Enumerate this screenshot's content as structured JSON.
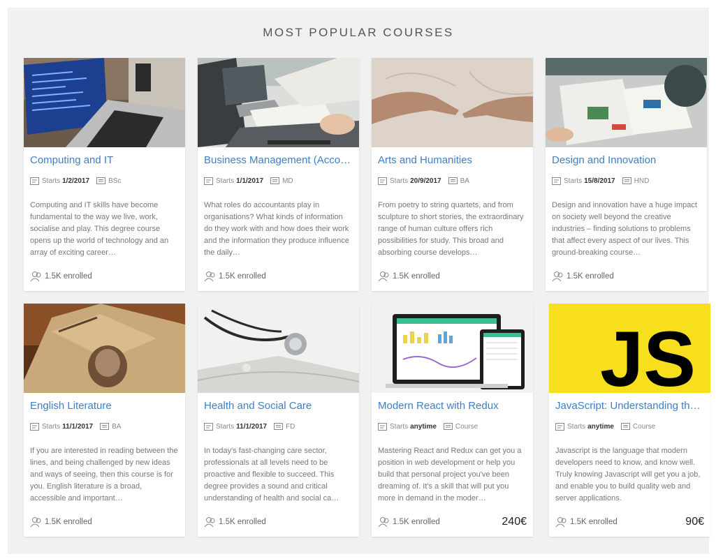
{
  "section": {
    "title": "MOST POPULAR COURSES"
  },
  "courses": [
    {
      "title": "Computing and IT",
      "starts_label": "Starts",
      "starts": "1/2/2017",
      "award": "BSc",
      "description": "Computing and IT skills have become fundamental to the way we live, work, socialise and play. This degree course opens up the world of technology and an array of exciting career…",
      "enrolled": "1.5K enrolled",
      "price": ""
    },
    {
      "title": "Business Management (Acco…",
      "starts_label": "Starts",
      "starts": "1/1/2017",
      "award": "MD",
      "description": "What roles do accountants play in organisations? What kinds of information do they work with and how does their work and the information they produce influence the daily…",
      "enrolled": "1.5K enrolled",
      "price": ""
    },
    {
      "title": "Arts and Humanities",
      "starts_label": "Starts",
      "starts": "20/9/2017",
      "award": "BA",
      "description": "From poetry to string quartets, and from sculpture to short stories, the extraordinary range of human culture offers rich possibilities for study. This broad and absorbing course develops…",
      "enrolled": "1.5K enrolled",
      "price": ""
    },
    {
      "title": "Design and Innovation",
      "starts_label": "Starts",
      "starts": "15/8/2017",
      "award": "HND",
      "description": "Design and innovation have a huge impact on society well beyond the creative industries – finding solutions to problems that affect every aspect of our lives. This ground-breaking course…",
      "enrolled": "1.5K enrolled",
      "price": ""
    },
    {
      "title": "English Literature",
      "starts_label": "Starts",
      "starts": "11/1/2017",
      "award": "BA",
      "description": "If you are interested in reading between the lines, and being challenged by new ideas and ways of seeing, then this course is for you. English literature is a broad, accessible and important…",
      "enrolled": "1.5K enrolled",
      "price": ""
    },
    {
      "title": "Health and Social Care",
      "starts_label": "Starts",
      "starts": "11/1/2017",
      "award": "FD",
      "description": "In today's fast-changing care sector, professionals at all levels need to be proactive and flexible to succeed. This degree provides a sound and critical understanding of health and social ca…",
      "enrolled": "1.5K enrolled",
      "price": ""
    },
    {
      "title": "Modern React with Redux",
      "starts_label": "Starts",
      "starts": "anytime",
      "award": "Course",
      "description": "Mastering React and Redux can get you a position in web development or help you build that personal project you've been dreaming of. It's a skill that will put you more in demand in the moder…",
      "enrolled": "1.5K enrolled",
      "price": "240€"
    },
    {
      "title": "JavaScript: Understanding the…",
      "starts_label": "Starts",
      "starts": "anytime",
      "award": "Course",
      "description": "Javascript is the language that modern developers need to know, and know well. Truly knowing Javascript will get you a job, and enable you to build quality web and server applications.",
      "enrolled": "1.5K enrolled",
      "price": "90€"
    }
  ],
  "thumb_text": {
    "js_logo": "JS"
  },
  "colors": {
    "title_blue": "#3d7fc8",
    "js_yellow": "#f7df1e",
    "panel_bg": "#f2f1f1"
  }
}
